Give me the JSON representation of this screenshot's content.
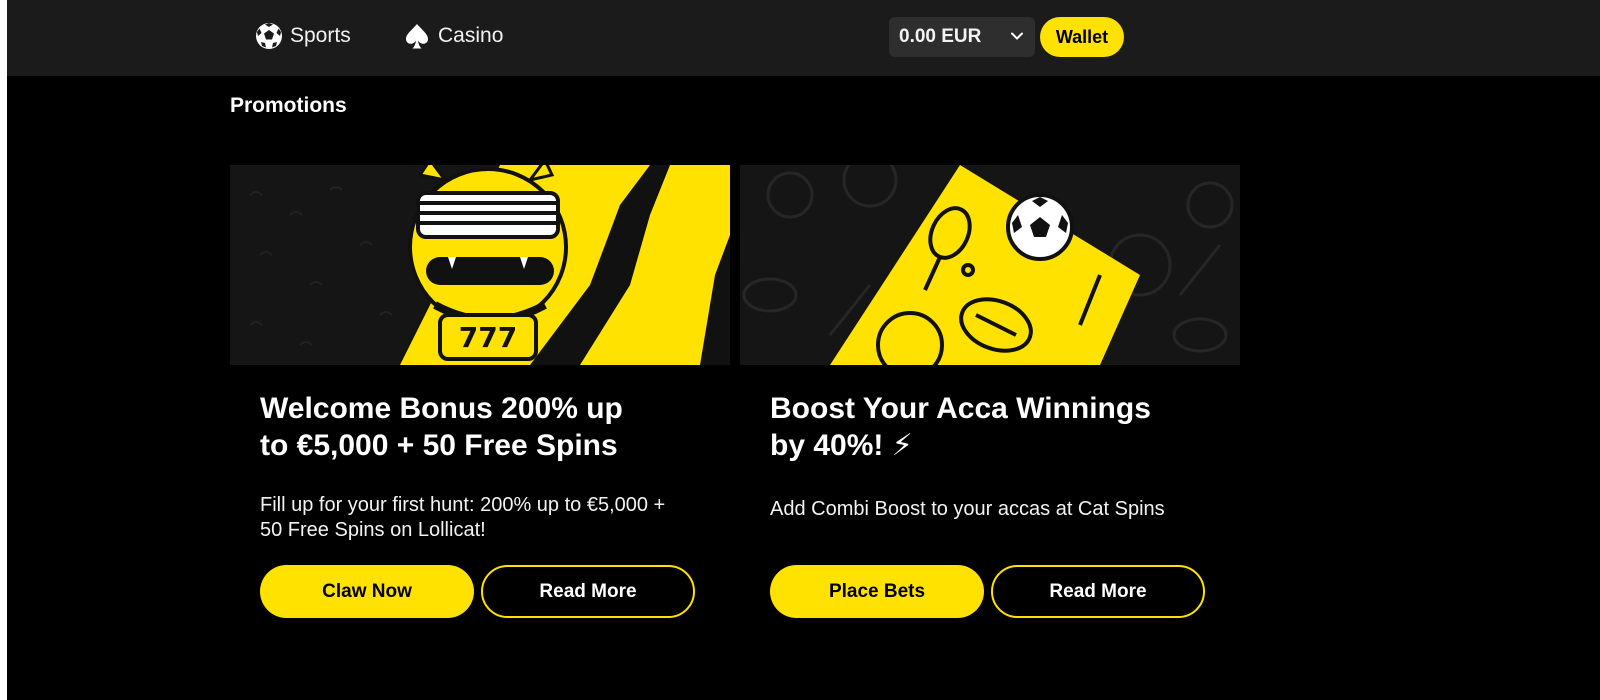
{
  "nav": {
    "items": [
      {
        "label": "Sports",
        "icon": "soccer-ball-icon"
      },
      {
        "label": "Casino",
        "icon": "spade-icon"
      }
    ]
  },
  "account": {
    "balance": "0.00 EUR",
    "wallet_label": "Wallet"
  },
  "page": {
    "title": "Promotions"
  },
  "promotions": [
    {
      "title": "Welcome Bonus 200% up\nto €5,000 + 50 Free Spins",
      "description": "Fill up for your first hunt: 200% up to €5,000 + 50 Free Spins on Lollicat!",
      "primary_label": "Claw Now",
      "secondary_label": "Read More",
      "banner_text": "777"
    },
    {
      "title": "Boost Your Acca Winnings\nby 40%! ⚡",
      "description": "Add Combi Boost to your accas at Cat Spins",
      "primary_label": "Place Bets",
      "secondary_label": "Read More"
    }
  ],
  "colors": {
    "accent": "#ffe200",
    "topbar": "#1b1b1b",
    "background": "#000000"
  }
}
